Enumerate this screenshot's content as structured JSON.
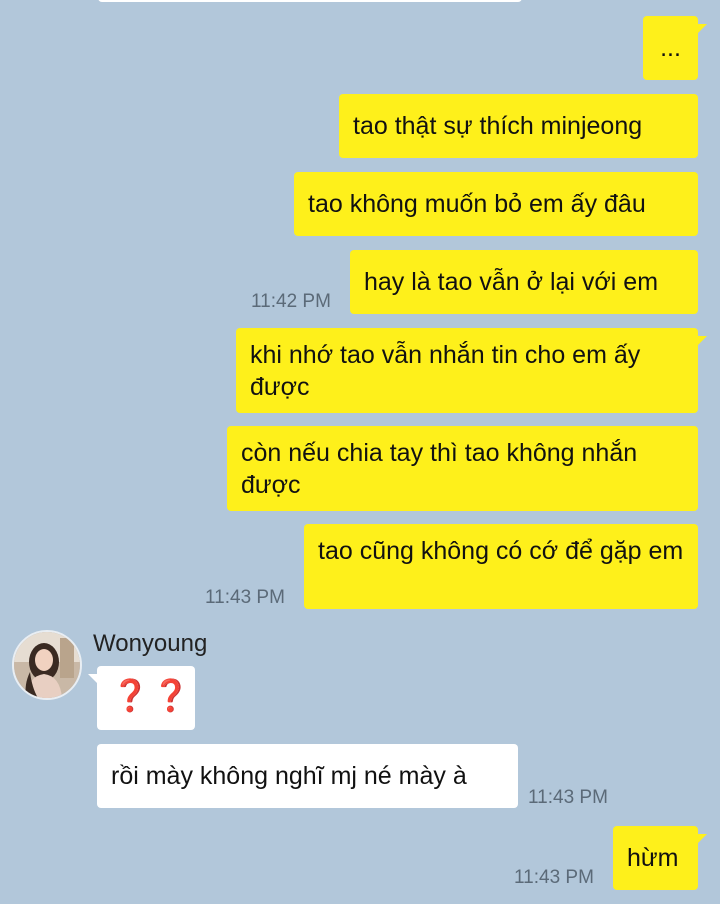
{
  "chat": {
    "sender_name": "Wonyoung",
    "messages": [
      {
        "id": "out-1",
        "text": "...",
        "outgoing": true
      },
      {
        "id": "out-2",
        "text": "tao thật sự thích minjeong",
        "outgoing": true
      },
      {
        "id": "out-3",
        "text": "tao không muốn bỏ em ấy đâu",
        "outgoing": true
      },
      {
        "id": "out-4",
        "text": "hay là tao vẫn ở lại với em",
        "outgoing": true,
        "time": "11:42 PM"
      },
      {
        "id": "out-5",
        "text": "khi nhớ tao vẫn nhắn tin cho em ấy được",
        "outgoing": true
      },
      {
        "id": "out-6",
        "text": "còn nếu chia tay thì tao không nhắn được",
        "outgoing": true
      },
      {
        "id": "out-7",
        "text": "tao cũng không có cớ để gặp em",
        "outgoing": true,
        "time": "11:43 PM"
      },
      {
        "id": "in-1",
        "text": "❓❓",
        "outgoing": false
      },
      {
        "id": "in-2",
        "text": "rồi mày không nghĩ mj né mày à",
        "outgoing": false,
        "time": "11:43 PM"
      },
      {
        "id": "out-8",
        "text": "hừm",
        "outgoing": true,
        "time": "11:43 PM"
      }
    ]
  },
  "colors": {
    "background": "#b2c7da",
    "outgoing_bubble": "#fef01b",
    "incoming_bubble": "#ffffff",
    "question_marks": "#d6242a"
  },
  "icons": {
    "avatar": "profile-photo-avatar"
  }
}
